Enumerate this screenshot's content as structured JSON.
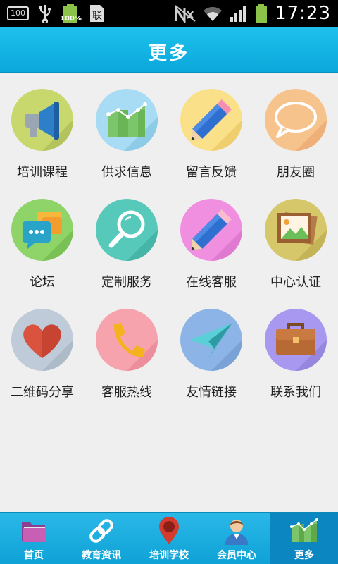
{
  "status_bar": {
    "sim_label": "100",
    "battery_small_label": "100%",
    "time": "17:23"
  },
  "header": {
    "title": "更多"
  },
  "grid": {
    "items": [
      {
        "label": "培训课程",
        "icon": "megaphone-icon",
        "bg": "#c8d86c"
      },
      {
        "label": "供求信息",
        "icon": "chart-icon",
        "bg": "#a8dcf4"
      },
      {
        "label": "留言反馈",
        "icon": "pencil-icon",
        "bg": "#fbe08a"
      },
      {
        "label": "朋友圈",
        "icon": "speech-bubble-icon",
        "bg": "#f7c38d"
      },
      {
        "label": "论坛",
        "icon": "chat-bubbles-icon",
        "bg": "#8ed468"
      },
      {
        "label": "定制服务",
        "icon": "magnifier-icon",
        "bg": "#56c9bb"
      },
      {
        "label": "在线客服",
        "icon": "pencil-icon",
        "bg": "#f08ee0"
      },
      {
        "label": "中心认证",
        "icon": "picture-icon",
        "bg": "#d6c76a"
      },
      {
        "label": "二维码分享",
        "icon": "heart-icon",
        "bg": "#bfcbd8"
      },
      {
        "label": "客服热线",
        "icon": "phone-icon",
        "bg": "#f6a3ae"
      },
      {
        "label": "友情链接",
        "icon": "paper-plane-icon",
        "bg": "#8cb4e6"
      },
      {
        "label": "联系我们",
        "icon": "briefcase-icon",
        "bg": "#a898f0"
      }
    ]
  },
  "tabs": [
    {
      "label": "首页",
      "icon": "folder-icon",
      "active": false
    },
    {
      "label": "教育资讯",
      "icon": "link-icon",
      "active": false
    },
    {
      "label": "培训学校",
      "icon": "map-pin-icon",
      "active": false
    },
    {
      "label": "会员中心",
      "icon": "user-icon",
      "active": false
    },
    {
      "label": "更多",
      "icon": "chart-icon",
      "active": true
    }
  ],
  "colors": {
    "header": "#12b3e3",
    "tabbar": "#1aaee0",
    "tab_active": "#0c86c1",
    "page_bg": "#efefef"
  }
}
